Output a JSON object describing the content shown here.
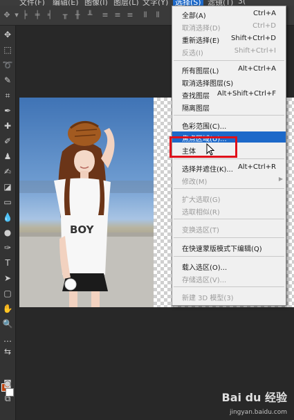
{
  "menubar": {
    "items": [
      {
        "label": "文件(F)"
      },
      {
        "label": "编辑(E)"
      },
      {
        "label": "图像(I)"
      },
      {
        "label": "图层(L)"
      },
      {
        "label": "文字(Y)"
      },
      {
        "label": "选择(S)"
      },
      {
        "label": "滤镜(T)"
      },
      {
        "label": "3("
      }
    ]
  },
  "select_menu": {
    "items": [
      {
        "label": "全部(A)",
        "shortcut": "Ctrl+A",
        "state": "enabled"
      },
      {
        "label": "取消选择(D)",
        "shortcut": "Ctrl+D",
        "state": "disabled"
      },
      {
        "label": "重新选择(E)",
        "shortcut": "Shift+Ctrl+D",
        "state": "enabled"
      },
      {
        "label": "反选(I)",
        "shortcut": "Shift+Ctrl+I",
        "state": "disabled"
      },
      {
        "label": "所有图层(L)",
        "shortcut": "Alt+Ctrl+A",
        "state": "enabled"
      },
      {
        "label": "取消选择图层(S)",
        "shortcut": "",
        "state": "enabled"
      },
      {
        "label": "查找图层",
        "shortcut": "Alt+Shift+Ctrl+F",
        "state": "enabled"
      },
      {
        "label": "隔离图层",
        "shortcut": "",
        "state": "enabled"
      },
      {
        "label": "色彩范围(C)...",
        "shortcut": "",
        "state": "enabled"
      },
      {
        "label": "焦点区域(U)...",
        "shortcut": "",
        "state": "highlighted"
      },
      {
        "label": "主体",
        "shortcut": "",
        "state": "enabled"
      },
      {
        "label": "选择并遮住(K)...",
        "shortcut": "Alt+Ctrl+R",
        "state": "enabled"
      },
      {
        "label": "修改(M)",
        "shortcut": "",
        "state": "disabled",
        "submenu_arrow": "▶"
      },
      {
        "label": "扩大选取(G)",
        "shortcut": "",
        "state": "disabled"
      },
      {
        "label": "选取相似(R)",
        "shortcut": "",
        "state": "disabled"
      },
      {
        "label": "变换选区(T)",
        "shortcut": "",
        "state": "disabled"
      },
      {
        "label": "在快速蒙版模式下编辑(Q)",
        "shortcut": "",
        "state": "enabled"
      },
      {
        "label": "载入选区(O)...",
        "shortcut": "",
        "state": "enabled"
      },
      {
        "label": "存储选区(V)...",
        "shortcut": "",
        "state": "disabled"
      },
      {
        "label": "新建 3D 模型(3)",
        "shortcut": "",
        "state": "disabled"
      }
    ]
  },
  "photo": {
    "shirt_text": "BOY"
  },
  "watermark": {
    "logo": "Bai du 经验",
    "url": "jingyan.baidu.com"
  },
  "colors": {
    "foreground": "#c1440e",
    "background": "#ffffff",
    "menu_highlight": "#1d69c9",
    "annotation_box": "#e0101a"
  }
}
